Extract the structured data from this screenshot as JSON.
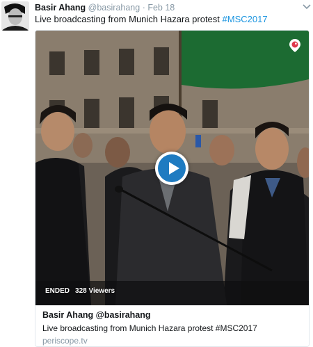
{
  "tweet": {
    "author_name": "Basir Ahang",
    "author_handle": "@basirahang",
    "separator": "·",
    "timestamp": "Feb 18",
    "text_prefix": "Live broadcasting from Munich Hazara protest ",
    "hashtag": "#MSC2017",
    "caret_icon": "chevron-down-icon"
  },
  "card": {
    "status": "ENDED",
    "viewers": "328 Viewers",
    "title": "Basir Ahang @basirahang",
    "description": "Live broadcasting from Munich Hazara protest #MSC2017",
    "domain": "periscope.tv",
    "play_icon": "play-icon",
    "badge_icon": "periscope-icon"
  },
  "colors": {
    "link": "#1b95e0",
    "muted": "#8899a6",
    "text": "#14171a",
    "play": "#1f7bc1",
    "periscope": "#e0384c",
    "flag": "#1c6b32"
  }
}
